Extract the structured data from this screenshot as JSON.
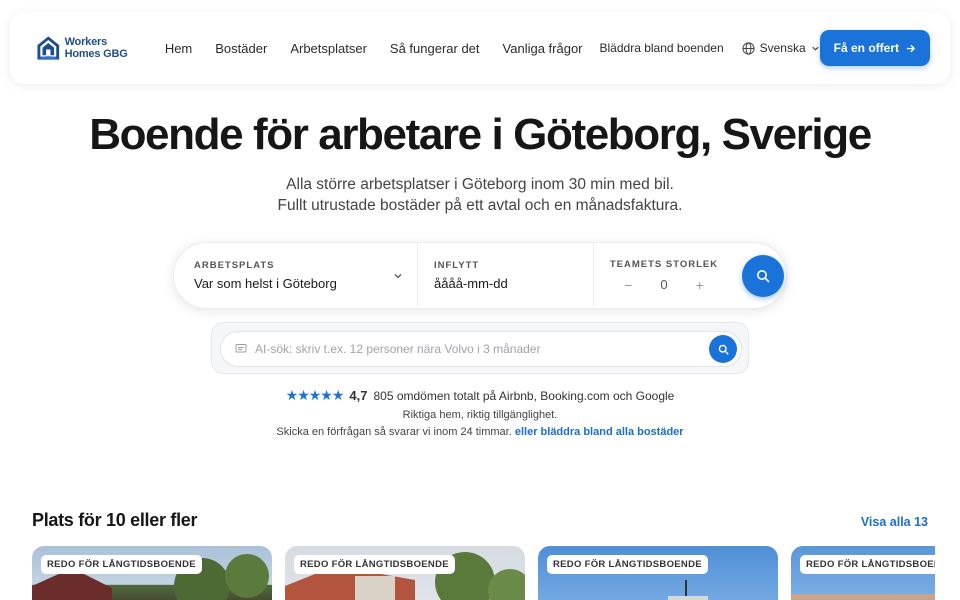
{
  "brand": {
    "name": "Workers Homes GBG"
  },
  "nav": {
    "items": [
      {
        "label": "Hem"
      },
      {
        "label": "Bostäder"
      },
      {
        "label": "Arbetsplatser"
      },
      {
        "label": "Så fungerar det"
      },
      {
        "label": "Vanliga frågor"
      }
    ],
    "browse_label": "Bläddra bland boenden",
    "language": "Svenska",
    "cta_label": "Få en offert"
  },
  "hero": {
    "title": "Boende för arbetare i Göteborg, Sverige",
    "subtitle_line1": "Alla större arbetsplatser i Göteborg inom 30 min med bil.",
    "subtitle_line2": "Fullt utrustade bostäder på ett avtal och en månadsfaktura."
  },
  "search": {
    "workplace_label": "ARBETSPLATS",
    "workplace_value": "Var som helst i Göteborg",
    "movein_label": "INFLYTT",
    "movein_value": "åååå-mm-dd",
    "team_label": "TEAMETS STORLEK",
    "team_minus": "−",
    "team_count": "0",
    "team_plus": "+"
  },
  "ai_search": {
    "placeholder": "AI-sök: skriv t.ex. 12 personer nära Volvo i 3 månader"
  },
  "reviews": {
    "stars": "★★★★★",
    "rating": "4,7",
    "text": "805 omdömen totalt på Airbnb, Booking.com och Google",
    "note_line1": "Riktiga hem, riktig tillgänglighet.",
    "note_line2": "Skicka en förfrågan så svarar vi inom 24 timmar.",
    "note_link": "eller bläddra bland alla bostäder"
  },
  "listings": {
    "title": "Plats för 10 eller fler",
    "see_all": "Visa alla 13",
    "cards": [
      {
        "badge": "REDO FÖR LÅNGTIDSBOENDE"
      },
      {
        "badge": "REDO FÖR LÅNGTIDSBOENDE"
      },
      {
        "badge": "REDO FÖR LÅNGTIDSBOENDE"
      },
      {
        "badge": "REDO FÖR LÅNGTIDSBOENDE"
      }
    ]
  },
  "colors": {
    "accent": "#1a73d8",
    "link": "#1a6fc7",
    "brand_text": "#1f4f8a"
  }
}
